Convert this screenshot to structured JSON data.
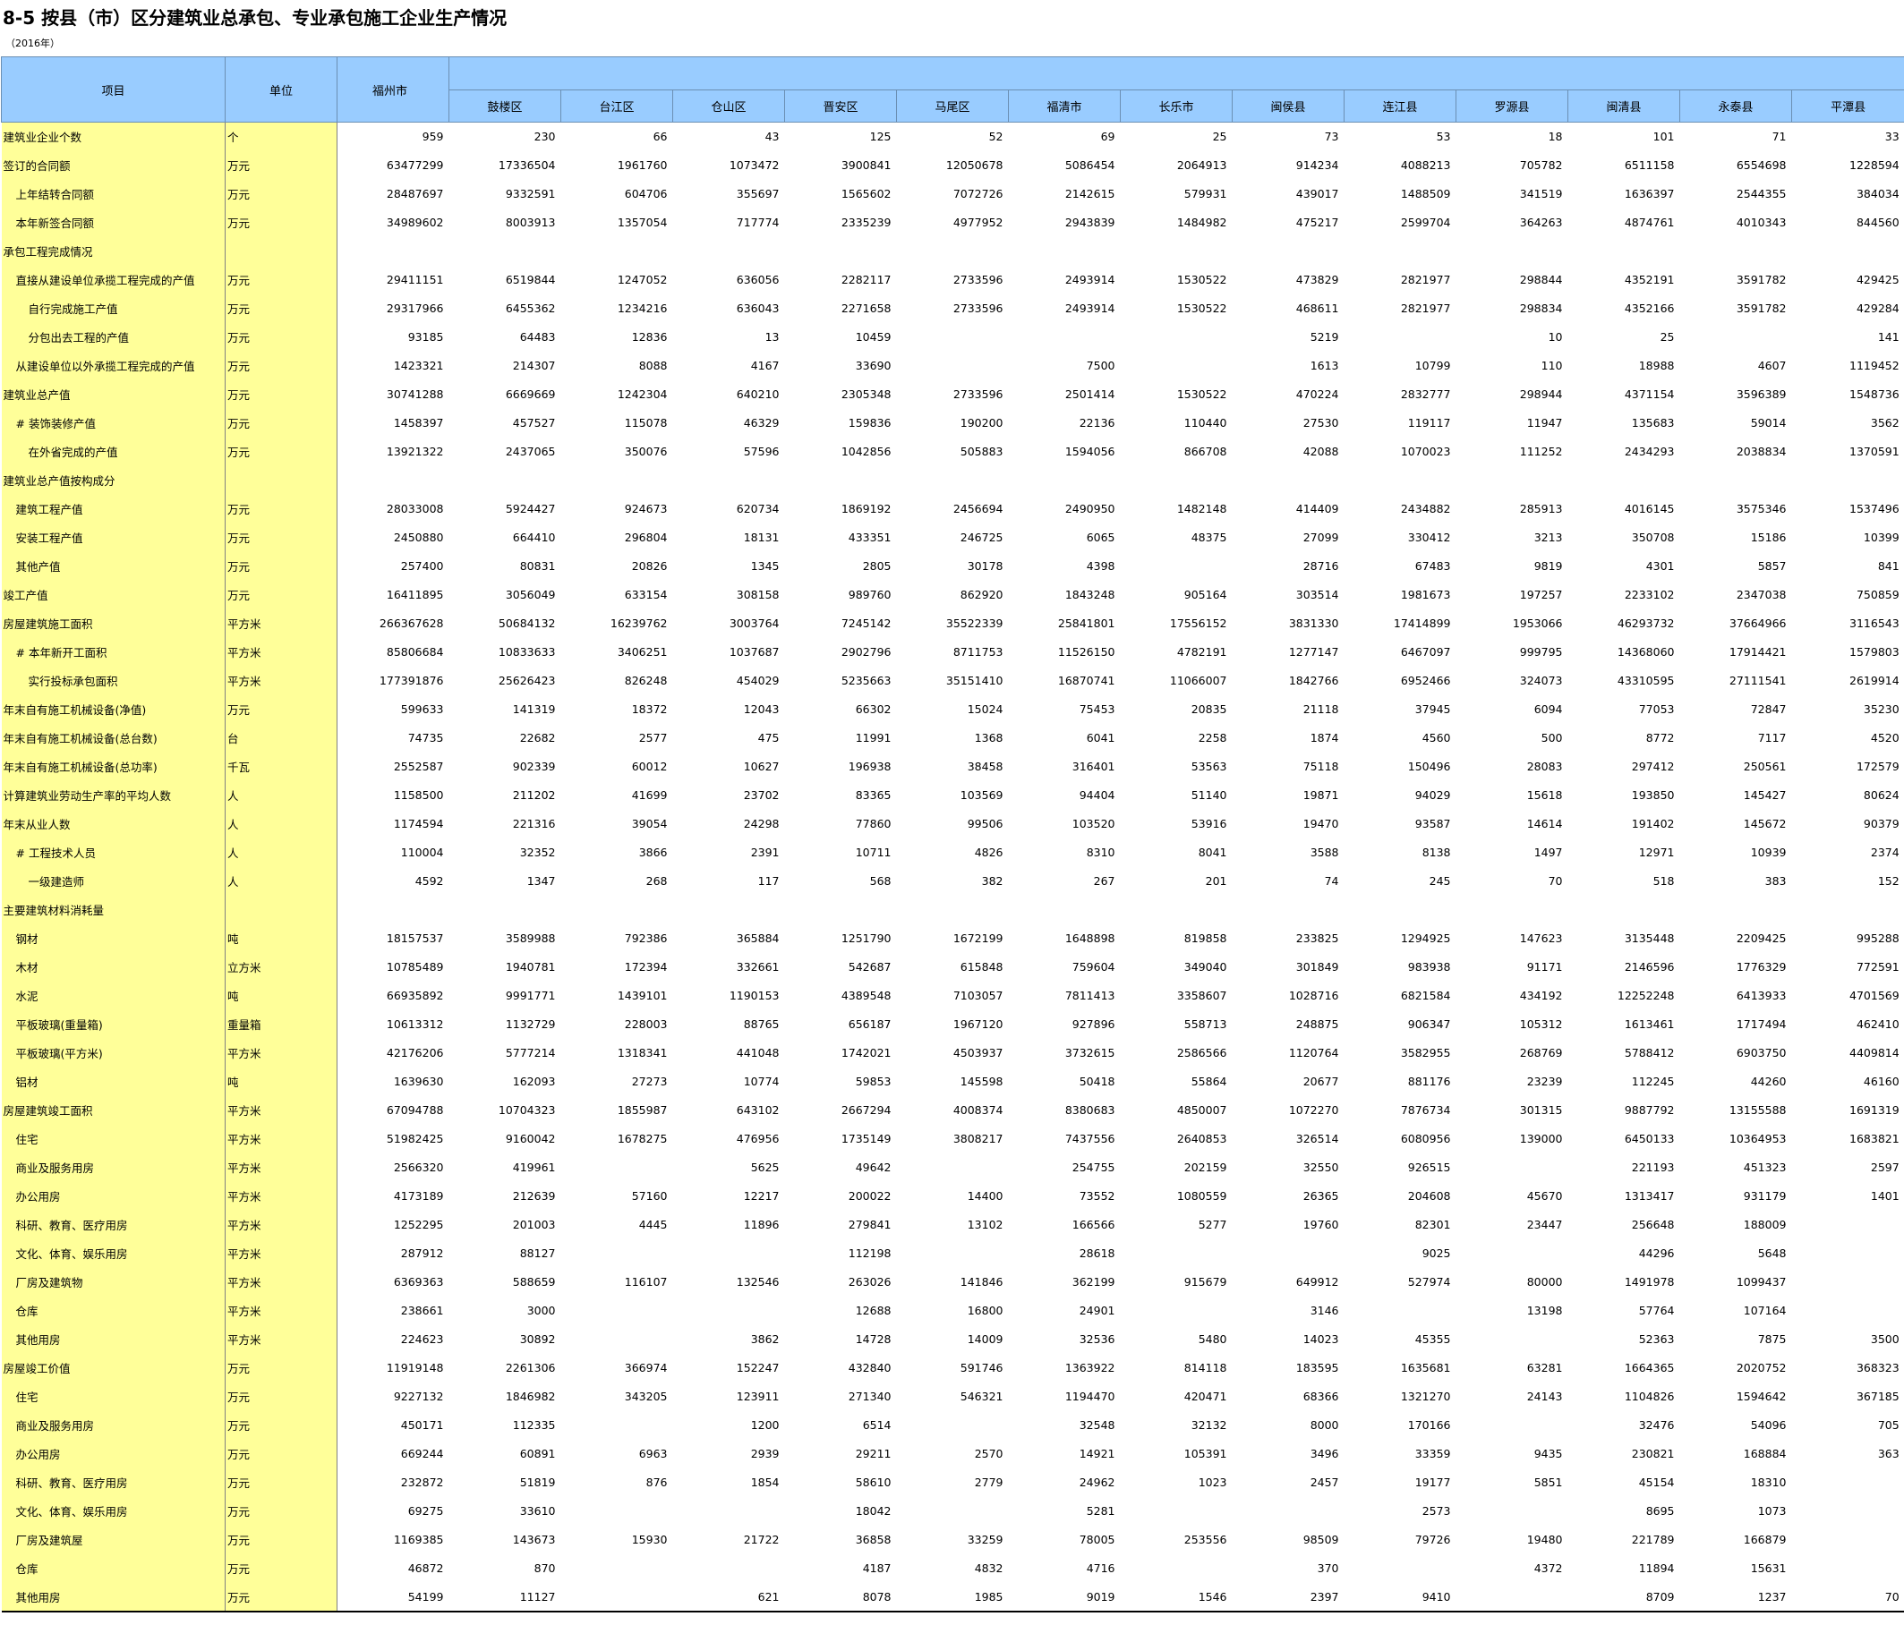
{
  "title": "8-5  按县（市）区分建筑业总承包、专业承包施工企业生产情况",
  "subtitle": "（2016年）",
  "header": {
    "item": "项目",
    "unit": "单位",
    "total": "福州市",
    "districts": [
      "鼓楼区",
      "台江区",
      "仓山区",
      "晋安区",
      "马尾区",
      "福清市",
      "长乐市",
      "闽侯县",
      "连江县",
      "罗源县",
      "闽清县",
      "永泰县",
      "平潭县"
    ]
  },
  "rows": [
    {
      "label": "建筑业企业个数",
      "unit": "个",
      "values": [
        "959",
        "230",
        "66",
        "43",
        "125",
        "52",
        "69",
        "25",
        "73",
        "53",
        "18",
        "101",
        "71",
        "33"
      ]
    },
    {
      "label": "签订的合同额",
      "unit": "万元",
      "values": [
        "63477299",
        "17336504",
        "1961760",
        "1073472",
        "3900841",
        "12050678",
        "5086454",
        "2064913",
        "914234",
        "4088213",
        "705782",
        "6511158",
        "6554698",
        "1228594"
      ]
    },
    {
      "label": "上年结转合同额",
      "unit": "万元",
      "values": [
        "28487697",
        "9332591",
        "604706",
        "355697",
        "1565602",
        "7072726",
        "2142615",
        "579931",
        "439017",
        "1488509",
        "341519",
        "1636397",
        "2544355",
        "384034"
      ]
    },
    {
      "label": "本年新签合同额",
      "unit": "万元",
      "values": [
        "34989602",
        "8003913",
        "1357054",
        "717774",
        "2335239",
        "4977952",
        "2943839",
        "1484982",
        "475217",
        "2599704",
        "364263",
        "4874761",
        "4010343",
        "844560"
      ]
    },
    {
      "label": "承包工程完成情况",
      "unit": "",
      "values": [
        "",
        "",
        "",
        "",
        "",
        "",
        "",
        "",
        "",
        "",
        "",
        "",
        "",
        ""
      ]
    },
    {
      "label": "直接从建设单位承揽工程完成的产值",
      "unit": "万元",
      "values": [
        "29411151",
        "6519844",
        "1247052",
        "636056",
        "2282117",
        "2733596",
        "2493914",
        "1530522",
        "473829",
        "2821977",
        "298844",
        "4352191",
        "3591782",
        "429425"
      ]
    },
    {
      "label": "自行完成施工产值",
      "unit": "万元",
      "values": [
        "29317966",
        "6455362",
        "1234216",
        "636043",
        "2271658",
        "2733596",
        "2493914",
        "1530522",
        "468611",
        "2821977",
        "298834",
        "4352166",
        "3591782",
        "429284"
      ]
    },
    {
      "label": "分包出去工程的产值",
      "unit": "万元",
      "values": [
        "93185",
        "64483",
        "12836",
        "13",
        "10459",
        "",
        "",
        "",
        "5219",
        "",
        "10",
        "25",
        "",
        "141"
      ]
    },
    {
      "label": "从建设单位以外承揽工程完成的产值",
      "unit": "万元",
      "values": [
        "1423321",
        "214307",
        "8088",
        "4167",
        "33690",
        "",
        "7500",
        "",
        "1613",
        "10799",
        "110",
        "18988",
        "4607",
        "1119452"
      ]
    },
    {
      "label": "建筑业总产值",
      "unit": "万元",
      "values": [
        "30741288",
        "6669669",
        "1242304",
        "640210",
        "2305348",
        "2733596",
        "2501414",
        "1530522",
        "470224",
        "2832777",
        "298944",
        "4371154",
        "3596389",
        "1548736"
      ]
    },
    {
      "label": "# 装饰装修产值",
      "unit": "万元",
      "values": [
        "1458397",
        "457527",
        "115078",
        "46329",
        "159836",
        "190200",
        "22136",
        "110440",
        "27530",
        "119117",
        "11947",
        "135683",
        "59014",
        "3562"
      ]
    },
    {
      "label": "在外省完成的产值",
      "unit": "万元",
      "values": [
        "13921322",
        "2437065",
        "350076",
        "57596",
        "1042856",
        "505883",
        "1594056",
        "866708",
        "42088",
        "1070023",
        "111252",
        "2434293",
        "2038834",
        "1370591"
      ]
    },
    {
      "label": "建筑业总产值按构成分",
      "unit": "",
      "values": [
        "",
        "",
        "",
        "",
        "",
        "",
        "",
        "",
        "",
        "",
        "",
        "",
        "",
        ""
      ]
    },
    {
      "label": "建筑工程产值",
      "unit": "万元",
      "values": [
        "28033008",
        "5924427",
        "924673",
        "620734",
        "1869192",
        "2456694",
        "2490950",
        "1482148",
        "414409",
        "2434882",
        "285913",
        "4016145",
        "3575346",
        "1537496"
      ]
    },
    {
      "label": "安装工程产值",
      "unit": "万元",
      "values": [
        "2450880",
        "664410",
        "296804",
        "18131",
        "433351",
        "246725",
        "6065",
        "48375",
        "27099",
        "330412",
        "3213",
        "350708",
        "15186",
        "10399"
      ]
    },
    {
      "label": "其他产值",
      "unit": "万元",
      "values": [
        "257400",
        "80831",
        "20826",
        "1345",
        "2805",
        "30178",
        "4398",
        "",
        "28716",
        "67483",
        "9819",
        "4301",
        "5857",
        "841"
      ]
    },
    {
      "label": "竣工产值",
      "unit": "万元",
      "values": [
        "16411895",
        "3056049",
        "633154",
        "308158",
        "989760",
        "862920",
        "1843248",
        "905164",
        "303514",
        "1981673",
        "197257",
        "2233102",
        "2347038",
        "750859"
      ]
    },
    {
      "label": "房屋建筑施工面积",
      "unit": "平方米",
      "values": [
        "266367628",
        "50684132",
        "16239762",
        "3003764",
        "7245142",
        "35522339",
        "25841801",
        "17556152",
        "3831330",
        "17414899",
        "1953066",
        "46293732",
        "37664966",
        "3116543"
      ]
    },
    {
      "label": "# 本年新开工面积",
      "unit": "平方米",
      "values": [
        "85806684",
        "10833633",
        "3406251",
        "1037687",
        "2902796",
        "8711753",
        "11526150",
        "4782191",
        "1277147",
        "6467097",
        "999795",
        "14368060",
        "17914421",
        "1579803"
      ]
    },
    {
      "label": "实行投标承包面积",
      "unit": "平方米",
      "values": [
        "177391876",
        "25626423",
        "826248",
        "454029",
        "5235663",
        "35151410",
        "16870741",
        "11066007",
        "1842766",
        "6952466",
        "324073",
        "43310595",
        "27111541",
        "2619914"
      ]
    },
    {
      "label": "年末自有施工机械设备(净值)",
      "unit": "万元",
      "values": [
        "599633",
        "141319",
        "18372",
        "12043",
        "66302",
        "15024",
        "75453",
        "20835",
        "21118",
        "37945",
        "6094",
        "77053",
        "72847",
        "35230"
      ]
    },
    {
      "label": "年末自有施工机械设备(总台数)",
      "unit": "台",
      "values": [
        "74735",
        "22682",
        "2577",
        "475",
        "11991",
        "1368",
        "6041",
        "2258",
        "1874",
        "4560",
        "500",
        "8772",
        "7117",
        "4520"
      ]
    },
    {
      "label": "年末自有施工机械设备(总功率)",
      "unit": "千瓦",
      "values": [
        "2552587",
        "902339",
        "60012",
        "10627",
        "196938",
        "38458",
        "316401",
        "53563",
        "75118",
        "150496",
        "28083",
        "297412",
        "250561",
        "172579"
      ]
    },
    {
      "label": "计算建筑业劳动生产率的平均人数",
      "unit": "人",
      "values": [
        "1158500",
        "211202",
        "41699",
        "23702",
        "83365",
        "103569",
        "94404",
        "51140",
        "19871",
        "94029",
        "15618",
        "193850",
        "145427",
        "80624"
      ]
    },
    {
      "label": "年末从业人数",
      "unit": "人",
      "values": [
        "1174594",
        "221316",
        "39054",
        "24298",
        "77860",
        "99506",
        "103520",
        "53916",
        "19470",
        "93587",
        "14614",
        "191402",
        "145672",
        "90379"
      ]
    },
    {
      "label": "# 工程技术人员",
      "unit": "人",
      "values": [
        "110004",
        "32352",
        "3866",
        "2391",
        "10711",
        "4826",
        "8310",
        "8041",
        "3588",
        "8138",
        "1497",
        "12971",
        "10939",
        "2374"
      ]
    },
    {
      "label": "一级建造师",
      "unit": "人",
      "values": [
        "4592",
        "1347",
        "268",
        "117",
        "568",
        "382",
        "267",
        "201",
        "74",
        "245",
        "70",
        "518",
        "383",
        "152"
      ]
    },
    {
      "label": "主要建筑材料消耗量",
      "unit": "",
      "values": [
        "",
        "",
        "",
        "",
        "",
        "",
        "",
        "",
        "",
        "",
        "",
        "",
        "",
        ""
      ]
    },
    {
      "label": "钢材",
      "unit": "吨",
      "values": [
        "18157537",
        "3589988",
        "792386",
        "365884",
        "1251790",
        "1672199",
        "1648898",
        "819858",
        "233825",
        "1294925",
        "147623",
        "3135448",
        "2209425",
        "995288"
      ]
    },
    {
      "label": "木材",
      "unit": "立方米",
      "values": [
        "10785489",
        "1940781",
        "172394",
        "332661",
        "542687",
        "615848",
        "759604",
        "349040",
        "301849",
        "983938",
        "91171",
        "2146596",
        "1776329",
        "772591"
      ]
    },
    {
      "label": "水泥",
      "unit": "吨",
      "values": [
        "66935892",
        "9991771",
        "1439101",
        "1190153",
        "4389548",
        "7103057",
        "7811413",
        "3358607",
        "1028716",
        "6821584",
        "434192",
        "12252248",
        "6413933",
        "4701569"
      ]
    },
    {
      "label": "平板玻璃(重量箱)",
      "unit": "重量箱",
      "values": [
        "10613312",
        "1132729",
        "228003",
        "88765",
        "656187",
        "1967120",
        "927896",
        "558713",
        "248875",
        "906347",
        "105312",
        "1613461",
        "1717494",
        "462410"
      ]
    },
    {
      "label": "平板玻璃(平方米)",
      "unit": "平方米",
      "values": [
        "42176206",
        "5777214",
        "1318341",
        "441048",
        "1742021",
        "4503937",
        "3732615",
        "2586566",
        "1120764",
        "3582955",
        "268769",
        "5788412",
        "6903750",
        "4409814"
      ]
    },
    {
      "label": "铝材",
      "unit": "吨",
      "values": [
        "1639630",
        "162093",
        "27273",
        "10774",
        "59853",
        "145598",
        "50418",
        "55864",
        "20677",
        "881176",
        "23239",
        "112245",
        "44260",
        "46160"
      ]
    },
    {
      "label": "房屋建筑竣工面积",
      "unit": "平方米",
      "values": [
        "67094788",
        "10704323",
        "1855987",
        "643102",
        "2667294",
        "4008374",
        "8380683",
        "4850007",
        "1072270",
        "7876734",
        "301315",
        "9887792",
        "13155588",
        "1691319"
      ]
    },
    {
      "label": "住宅",
      "unit": "平方米",
      "values": [
        "51982425",
        "9160042",
        "1678275",
        "476956",
        "1735149",
        "3808217",
        "7437556",
        "2640853",
        "326514",
        "6080956",
        "139000",
        "6450133",
        "10364953",
        "1683821"
      ]
    },
    {
      "label": "商业及服务用房",
      "unit": "平方米",
      "values": [
        "2566320",
        "419961",
        "",
        "5625",
        "49642",
        "",
        "254755",
        "202159",
        "32550",
        "926515",
        "",
        "221193",
        "451323",
        "2597"
      ]
    },
    {
      "label": "办公用房",
      "unit": "平方米",
      "values": [
        "4173189",
        "212639",
        "57160",
        "12217",
        "200022",
        "14400",
        "73552",
        "1080559",
        "26365",
        "204608",
        "45670",
        "1313417",
        "931179",
        "1401"
      ]
    },
    {
      "label": "科研、教育、医疗用房",
      "unit": "平方米",
      "values": [
        "1252295",
        "201003",
        "4445",
        "11896",
        "279841",
        "13102",
        "166566",
        "5277",
        "19760",
        "82301",
        "23447",
        "256648",
        "188009",
        ""
      ]
    },
    {
      "label": "文化、体育、娱乐用房",
      "unit": "平方米",
      "values": [
        "287912",
        "88127",
        "",
        "",
        "112198",
        "",
        "28618",
        "",
        "",
        "9025",
        "",
        "44296",
        "5648",
        ""
      ]
    },
    {
      "label": "厂房及建筑物",
      "unit": "平方米",
      "values": [
        "6369363",
        "588659",
        "116107",
        "132546",
        "263026",
        "141846",
        "362199",
        "915679",
        "649912",
        "527974",
        "80000",
        "1491978",
        "1099437",
        ""
      ]
    },
    {
      "label": "仓库",
      "unit": "平方米",
      "values": [
        "238661",
        "3000",
        "",
        "",
        "12688",
        "16800",
        "24901",
        "",
        "3146",
        "",
        "13198",
        "57764",
        "107164",
        ""
      ]
    },
    {
      "label": "其他用房",
      "unit": "平方米",
      "values": [
        "224623",
        "30892",
        "",
        "3862",
        "14728",
        "14009",
        "32536",
        "5480",
        "14023",
        "45355",
        "",
        "52363",
        "7875",
        "3500"
      ]
    },
    {
      "label": "房屋竣工价值",
      "unit": "万元",
      "values": [
        "11919148",
        "2261306",
        "366974",
        "152247",
        "432840",
        "591746",
        "1363922",
        "814118",
        "183595",
        "1635681",
        "63281",
        "1664365",
        "2020752",
        "368323"
      ]
    },
    {
      "label": "住宅",
      "unit": "万元",
      "values": [
        "9227132",
        "1846982",
        "343205",
        "123911",
        "271340",
        "546321",
        "1194470",
        "420471",
        "68366",
        "1321270",
        "24143",
        "1104826",
        "1594642",
        "367185"
      ]
    },
    {
      "label": "商业及服务用房",
      "unit": "万元",
      "values": [
        "450171",
        "112335",
        "",
        "1200",
        "6514",
        "",
        "32548",
        "32132",
        "8000",
        "170166",
        "",
        "32476",
        "54096",
        "705"
      ]
    },
    {
      "label": "办公用房",
      "unit": "万元",
      "values": [
        "669244",
        "60891",
        "6963",
        "2939",
        "29211",
        "2570",
        "14921",
        "105391",
        "3496",
        "33359",
        "9435",
        "230821",
        "168884",
        "363"
      ]
    },
    {
      "label": "科研、教育、医疗用房",
      "unit": "万元",
      "values": [
        "232872",
        "51819",
        "876",
        "1854",
        "58610",
        "2779",
        "24962",
        "1023",
        "2457",
        "19177",
        "5851",
        "45154",
        "18310",
        ""
      ]
    },
    {
      "label": "文化、体育、娱乐用房",
      "unit": "万元",
      "values": [
        "69275",
        "33610",
        "",
        "",
        "18042",
        "",
        "5281",
        "",
        "",
        "2573",
        "",
        "8695",
        "1073",
        ""
      ]
    },
    {
      "label": "厂房及建筑屋",
      "unit": "万元",
      "values": [
        "1169385",
        "143673",
        "15930",
        "21722",
        "36858",
        "33259",
        "78005",
        "253556",
        "98509",
        "79726",
        "19480",
        "221789",
        "166879",
        ""
      ]
    },
    {
      "label": "仓库",
      "unit": "万元",
      "values": [
        "46872",
        "870",
        "",
        "",
        "4187",
        "4832",
        "4716",
        "",
        "370",
        "",
        "4372",
        "11894",
        "15631",
        ""
      ]
    },
    {
      "label": "其他用房",
      "unit": "万元",
      "values": [
        "54199",
        "11127",
        "",
        "621",
        "8078",
        "1985",
        "9019",
        "1546",
        "2397",
        "9410",
        "",
        "8709",
        "1237",
        "70"
      ]
    }
  ]
}
